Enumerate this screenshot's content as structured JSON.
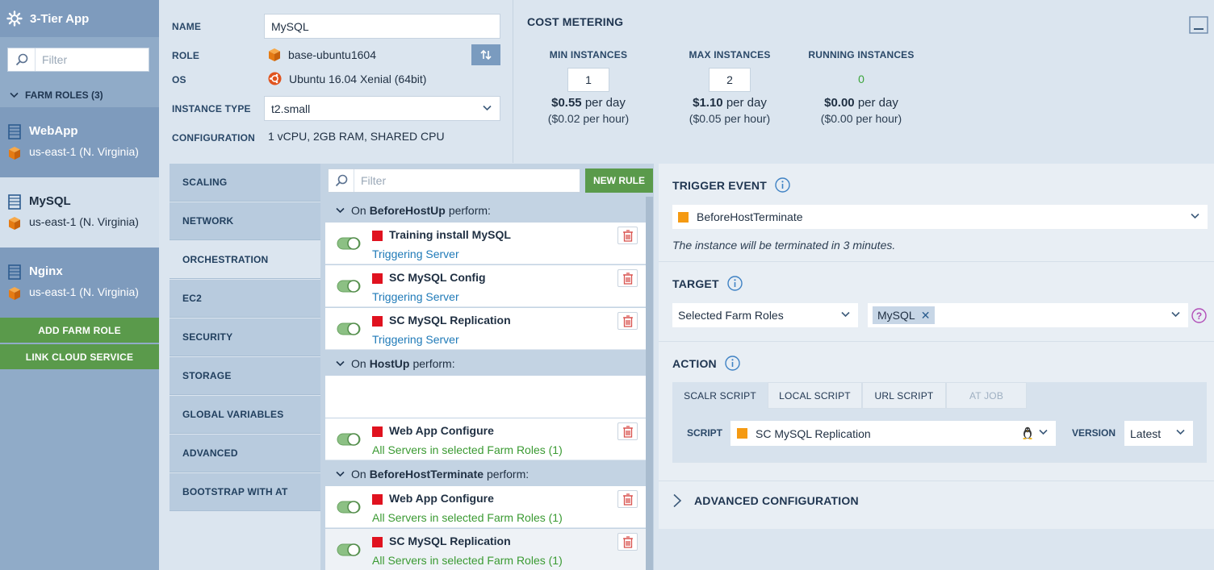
{
  "app": {
    "title": "3-Tier App"
  },
  "sidebar": {
    "filter_placeholder": "Filter",
    "farm_roles_header": "FARM ROLES (3)",
    "farm_roles": [
      {
        "name": "WebApp",
        "region": "us-east-1 (N. Virginia)"
      },
      {
        "name": "MySQL",
        "region": "us-east-1 (N. Virginia)"
      },
      {
        "name": "Nginx",
        "region": "us-east-1 (N. Virginia)"
      }
    ],
    "add_farm_role": "ADD FARM ROLE",
    "link_cloud_service": "LINK CLOUD SERVICE"
  },
  "props": {
    "name_label": "NAME",
    "name_value": "MySQL",
    "role_label": "ROLE",
    "role_value": "base-ubuntu1604",
    "os_label": "OS",
    "os_value": "Ubuntu 16.04 Xenial (64bit)",
    "instance_type_label": "INSTANCE TYPE",
    "instance_type_value": "t2.small",
    "configuration_label": "CONFIGURATION",
    "configuration_value": "1 vCPU, 2GB RAM, SHARED CPU"
  },
  "cost": {
    "title": "COST METERING",
    "min": {
      "label": "MIN INSTANCES",
      "value": "1",
      "per_day_amount": "$0.55",
      "per_day_unit": "per day",
      "per_hour": "($0.02 per hour)"
    },
    "max": {
      "label": "MAX INSTANCES",
      "value": "2",
      "per_day_amount": "$1.10",
      "per_day_unit": "per day",
      "per_hour": "($0.05 per hour)"
    },
    "running": {
      "label": "RUNNING INSTANCES",
      "value": "0",
      "per_day_amount": "$0.00",
      "per_day_unit": "per day",
      "per_hour": "($0.00 per hour)"
    }
  },
  "tabs": [
    "SCALING",
    "NETWORK",
    "ORCHESTRATION",
    "EC2",
    "SECURITY",
    "STORAGE",
    "GLOBAL VARIABLES",
    "ADVANCED",
    "BOOTSTRAP WITH AT"
  ],
  "rules": {
    "filter_placeholder": "Filter",
    "new_rule": "NEW RULE",
    "groups": [
      {
        "prefix": "On",
        "event": "BeforeHostUp",
        "suffix": "perform:",
        "items": [
          {
            "title": "Training install MySQL",
            "target": "Triggering Server"
          },
          {
            "title": "SC MySQL Config",
            "target": "Triggering Server"
          },
          {
            "title": "SC MySQL Replication",
            "target": "Triggering Server"
          }
        ]
      },
      {
        "prefix": "On",
        "event": "HostUp",
        "suffix": "perform:",
        "items": [
          {
            "title": "Web App Configure",
            "target": "All Servers in selected Farm Roles (1)"
          }
        ]
      },
      {
        "prefix": "On",
        "event": "BeforeHostTerminate",
        "suffix": "perform:",
        "items": [
          {
            "title": "Web App Configure",
            "target": "All Servers in selected Farm Roles (1)"
          },
          {
            "title": "SC MySQL Replication",
            "target": "All Servers in selected Farm Roles (1)"
          }
        ]
      }
    ]
  },
  "detail": {
    "trigger_event_title": "TRIGGER EVENT",
    "trigger_event_value": "BeforeHostTerminate",
    "trigger_note": "The instance will be terminated in 3 minutes.",
    "target_title": "TARGET",
    "target_value": "Selected Farm Roles",
    "target_tag": "MySQL",
    "action_title": "ACTION",
    "action_tabs": [
      "SCALR SCRIPT",
      "LOCAL SCRIPT",
      "URL SCRIPT",
      "AT JOB"
    ],
    "script_label": "SCRIPT",
    "script_value": "SC MySQL Replication",
    "version_label": "VERSION",
    "version_value": "Latest",
    "advanced_config": "ADVANCED CONFIGURATION"
  },
  "colors": {
    "accent_green": "#5a9a4b",
    "sidebar_bg": "#90abc8",
    "rule_red": "#e0121f",
    "script_orange": "#f59a12",
    "link_blue": "#1f7ab8",
    "target_green": "#3a9a32"
  }
}
